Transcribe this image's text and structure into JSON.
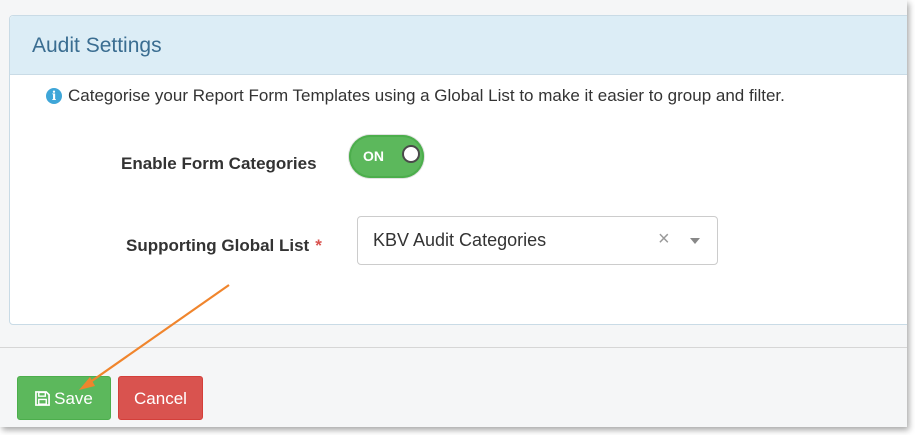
{
  "panel": {
    "title": "Audit Settings"
  },
  "info": {
    "icon": "info-icon",
    "glyph": "i",
    "text": "Categorise your Report Form Templates using a Global List to make it easier to group and filter."
  },
  "form": {
    "enable_label": "Enable Form Categories",
    "toggle_text": "ON",
    "toggle_state": true,
    "list_label": "Supporting Global List",
    "required_mark": "*",
    "list_value": "KBV Audit Categories",
    "clear_glyph": "×"
  },
  "footer": {
    "save_label": "Save",
    "cancel_label": "Cancel"
  },
  "colors": {
    "heading_bg": "#dcedf6",
    "heading_text": "#3a6d91",
    "success": "#5cb85c",
    "danger": "#d9534f",
    "annotation_arrow": "#f0852d"
  }
}
